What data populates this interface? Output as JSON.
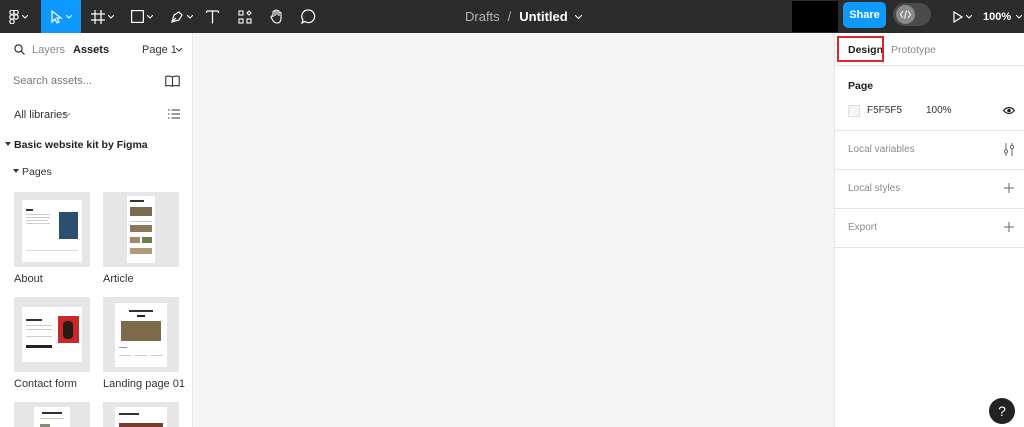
{
  "toolbar": {
    "file_location": "Drafts",
    "separator": "/",
    "file_name": "Untitled",
    "share_label": "Share",
    "zoom": "100%",
    "active_tool": "move-tool",
    "accent": "#0d99ff"
  },
  "left_panel": {
    "tabs": [
      "Layers",
      "Assets"
    ],
    "active_tab": "Assets",
    "page_selector": "Page 1",
    "search_placeholder": "Search assets...",
    "libraries_label": "All libraries",
    "library_name": "Basic website kit by Figma",
    "section_label": "Pages",
    "pages": [
      "About",
      "Article",
      "Contact form",
      "Landing page 01",
      "",
      ""
    ]
  },
  "right_panel": {
    "tabs": [
      "Design",
      "Prototype"
    ],
    "active_tab": "Design",
    "page_section_title": "Page",
    "page_color": "F5F5F5",
    "page_opacity": "100%",
    "sections": [
      "Local variables",
      "Local styles",
      "Export"
    ]
  },
  "help_label": "?"
}
